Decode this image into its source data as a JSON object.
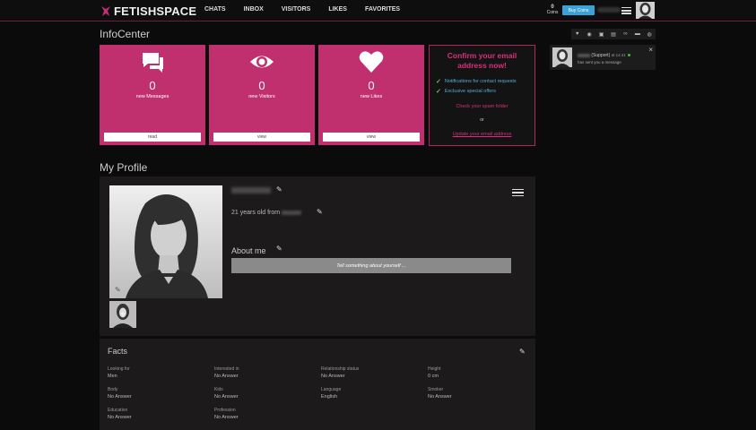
{
  "brand": {
    "name": "FETISHSPACE"
  },
  "nav": [
    "CHATS",
    "INBOX",
    "VISITORS",
    "LIKES",
    "FAVORITES"
  ],
  "header": {
    "coins_value": "0",
    "coins_label": "Coins",
    "buy_coins": "Buy Coins"
  },
  "infocenter": {
    "title": "InfoCenter",
    "cards": [
      {
        "icon": "messages-icon",
        "count": "0",
        "label": "new Messages",
        "button": "read"
      },
      {
        "icon": "eye-icon",
        "count": "0",
        "label": "new Visitors",
        "button": "view"
      },
      {
        "icon": "heart-icon",
        "count": "0",
        "label": "new Likes",
        "button": "view"
      }
    ],
    "confirm": {
      "title": "Confirm your email address now!",
      "checks": [
        "Notifications for contact requests",
        "Exclusive special offers"
      ],
      "spam": "Check your spam folder",
      "or": "or",
      "update": "Update your email address"
    }
  },
  "notification": {
    "sender_suffix": "(Support)",
    "time": "at 14:41",
    "message": "has sent you a message"
  },
  "profile": {
    "title": "My Profile",
    "age_text": "21 years old from",
    "about_title": "About me",
    "about_placeholder": "Tell something about yourself ..."
  },
  "facts": {
    "title": "Facts",
    "items": [
      {
        "key": "Looking for",
        "value": "Men"
      },
      {
        "key": "Interested in",
        "value": "No Answer"
      },
      {
        "key": "Relationship status",
        "value": "No Answer"
      },
      {
        "key": "Height",
        "value": "0 cm"
      },
      {
        "key": "Body",
        "value": "No Answer"
      },
      {
        "key": "Kids",
        "value": "No Answer"
      },
      {
        "key": "Language",
        "value": "English"
      },
      {
        "key": "Smoker",
        "value": "No Answer"
      },
      {
        "key": "Education",
        "value": "No Answer"
      },
      {
        "key": "Profession",
        "value": "No Answer"
      }
    ]
  },
  "colors": {
    "accent": "#c0306e",
    "buy": "#3aa2d6",
    "link": "#5aa9d8"
  }
}
